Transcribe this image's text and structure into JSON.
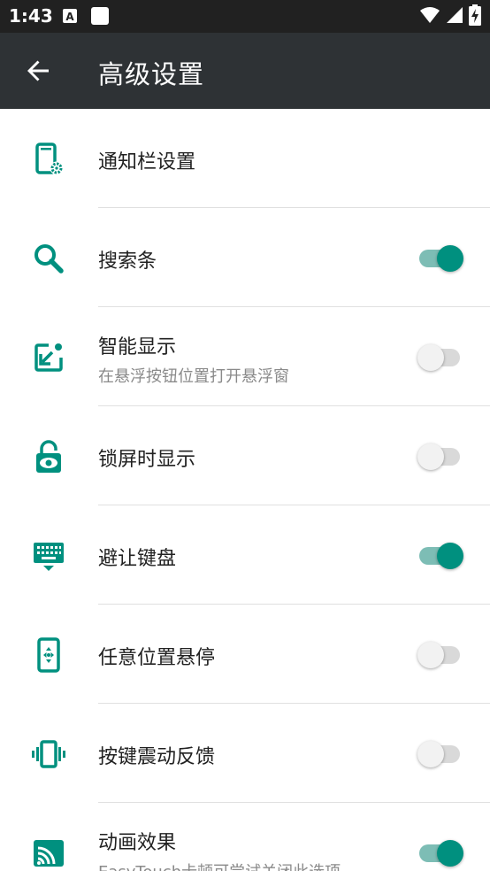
{
  "status_bar": {
    "time": "1:43",
    "icons": [
      "text-a-icon",
      "square-notification-icon",
      "wifi-icon",
      "signal-icon",
      "battery-charging-icon"
    ]
  },
  "toolbar": {
    "title": "高级设置",
    "back_icon": "arrow-back-icon"
  },
  "colors": {
    "accent": "#00907f",
    "toolbar": "#2e3235",
    "status_bar": "#212121"
  },
  "settings": [
    {
      "label": "通知栏设置",
      "subtitle": "",
      "icon": "phone-settings-icon",
      "switch": null
    },
    {
      "label": "搜索条",
      "subtitle": "",
      "icon": "search-icon",
      "switch": true
    },
    {
      "label": "智能显示",
      "subtitle": "在悬浮按钮位置打开悬浮窗",
      "icon": "arrow-into-box-icon",
      "switch": false
    },
    {
      "label": "锁屏时显示",
      "subtitle": "",
      "icon": "lock-eye-icon",
      "switch": false
    },
    {
      "label": "避让键盘",
      "subtitle": "",
      "icon": "keyboard-hide-icon",
      "switch": true
    },
    {
      "label": "任意位置悬停",
      "subtitle": "",
      "icon": "phone-move-icon",
      "switch": false
    },
    {
      "label": "按键震动反馈",
      "subtitle": "",
      "icon": "vibrate-icon",
      "switch": false
    },
    {
      "label": "动画效果",
      "subtitle": "EasyTouch卡顿可尝试关闭此选项",
      "icon": "cast-icon",
      "switch": true
    }
  ]
}
